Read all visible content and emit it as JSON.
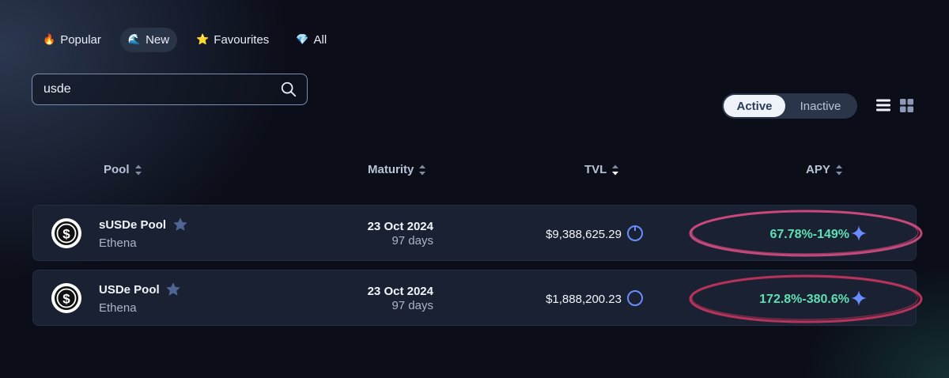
{
  "filters": [
    {
      "icon": "🔥",
      "icon_name": "fire-icon",
      "label": "Popular",
      "active": false
    },
    {
      "icon": "🌊",
      "icon_name": "wave-icon",
      "label": "New",
      "active": true
    },
    {
      "icon": "⭐",
      "icon_name": "star-icon",
      "label": "Favourites",
      "active": false
    },
    {
      "icon": "💎",
      "icon_name": "diamond-icon",
      "label": "All",
      "active": false
    }
  ],
  "search": {
    "value": "usde",
    "placeholder": ""
  },
  "status_toggle": {
    "active_label": "Active",
    "inactive_label": "Inactive",
    "selected": "Active"
  },
  "table": {
    "headers": {
      "pool": "Pool",
      "maturity": "Maturity",
      "tvl": "TVL",
      "apy": "APY"
    },
    "sorted_by": "TVL",
    "rows": [
      {
        "name": "sUSDe Pool",
        "protocol": "Ethena",
        "maturity_date": "23 Oct 2024",
        "maturity_days": "97 days",
        "tvl": "$9,388,625.29",
        "apy": "67.78%-149%",
        "logo": "susde-logo"
      },
      {
        "name": "USDe Pool",
        "protocol": "Ethena",
        "maturity_date": "23 Oct 2024",
        "maturity_days": "97 days",
        "tvl": "$1,888,200.23",
        "apy": "172.8%-380.6%",
        "logo": "usde-logo"
      }
    ]
  },
  "colors": {
    "background": "#0b0e19",
    "row_background": "#1a2133",
    "apy_green": "#5ee0b3",
    "accent_blue": "#6b8cff",
    "annotation_pink": "#d9477a"
  }
}
